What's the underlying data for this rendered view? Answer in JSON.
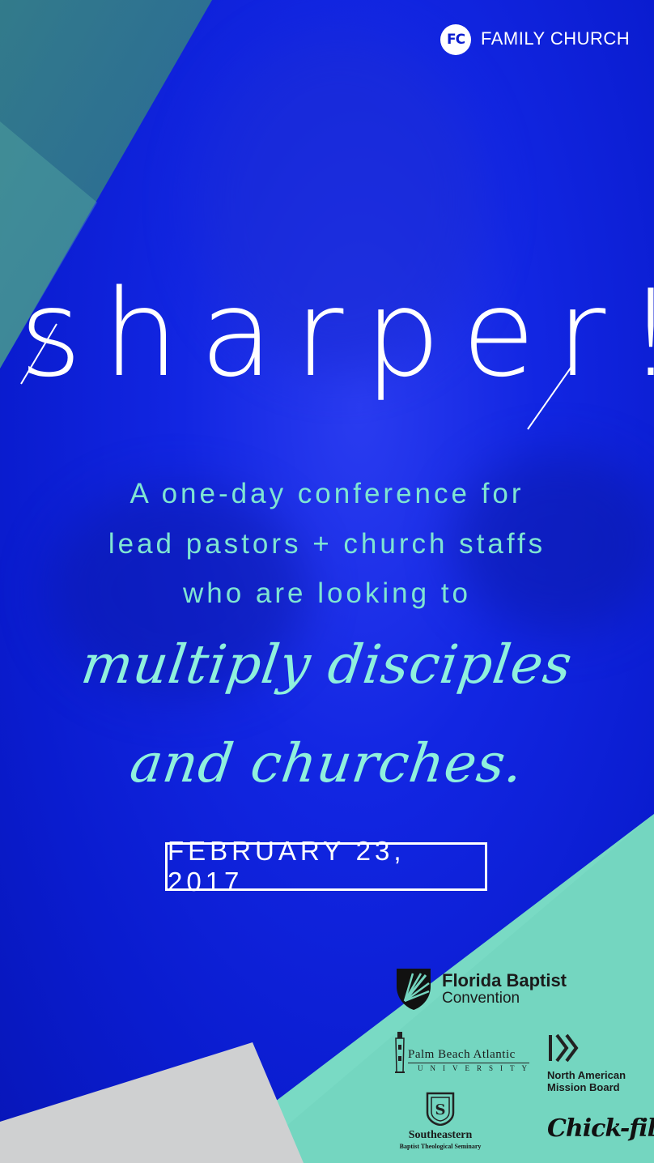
{
  "brand": {
    "logo_initials": "FC",
    "name": "FAMILY CHURCH"
  },
  "event": {
    "title": "sharper!",
    "subtitle_lines": [
      "A one-day conference for",
      "lead pastors + church staffs",
      "who are looking to"
    ],
    "highlight_lines": [
      "multiply disciples",
      "and churches."
    ],
    "date": "FEBRUARY 23, 2017"
  },
  "sponsors": {
    "fbc": {
      "line1": "Florida Baptist",
      "line2": "Convention",
      "icon": "shield-leaf-icon"
    },
    "pba": {
      "name": "Palm Beach Atlantic",
      "sub": "UNIVERSITY",
      "icon": "lighthouse-icon"
    },
    "namb": {
      "line1": "North American",
      "line2": "Mission Board",
      "icon": "chevrons-right-icon"
    },
    "sebts": {
      "name": "Southeastern",
      "sub": "Baptist Theological Seminary",
      "icon": "seal-icon"
    },
    "cfa": {
      "name": "Chick-fil-A"
    }
  },
  "colors": {
    "background_blue": "#1226e2",
    "mint": "#74d6c0",
    "teal_dark": "#2f7d74",
    "gray": "#cfd0d1",
    "accent_text": "#7fe5d2",
    "white": "#ffffff"
  }
}
